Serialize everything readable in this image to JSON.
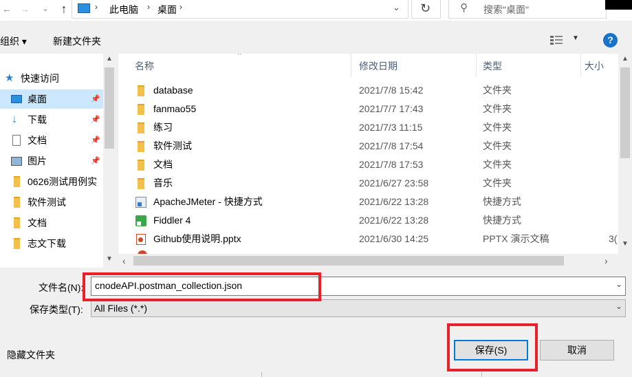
{
  "address": {
    "path": [
      "此电脑",
      "桌面"
    ],
    "search_placeholder": "搜索\"桌面\""
  },
  "toolbar": {
    "organize": "组织 ▾",
    "new_folder": "新建文件夹",
    "help": "?"
  },
  "sidebar": {
    "items": [
      {
        "label": "快速访问",
        "icon": "star-icon"
      },
      {
        "label": "桌面",
        "icon": "desktop-icon",
        "pinned": true,
        "selected": true
      },
      {
        "label": "下载",
        "icon": "download-icon",
        "pinned": true
      },
      {
        "label": "文档",
        "icon": "document-icon",
        "pinned": true
      },
      {
        "label": "图片",
        "icon": "picture-icon",
        "pinned": true
      },
      {
        "label": "0626测试用例实",
        "icon": "folder-icon"
      },
      {
        "label": "软件测试",
        "icon": "folder-icon"
      },
      {
        "label": "文档",
        "icon": "folder-icon"
      },
      {
        "label": "志文下载",
        "icon": "folder-icon"
      }
    ]
  },
  "columns": {
    "name": "名称",
    "date": "修改日期",
    "type": "类型",
    "size": "大小"
  },
  "files": [
    {
      "name": "database",
      "date": "2021/7/8 15:42",
      "type": "文件夹",
      "size": "",
      "icon": "folder-icon"
    },
    {
      "name": "fanmao55",
      "date": "2021/7/7 17:43",
      "type": "文件夹",
      "size": "",
      "icon": "folder-icon"
    },
    {
      "name": "练习",
      "date": "2021/7/3 11:15",
      "type": "文件夹",
      "size": "",
      "icon": "folder-icon"
    },
    {
      "name": "软件测试",
      "date": "2021/7/8 17:54",
      "type": "文件夹",
      "size": "",
      "icon": "folder-icon"
    },
    {
      "name": "文档",
      "date": "2021/7/8 17:53",
      "type": "文件夹",
      "size": "",
      "icon": "folder-icon"
    },
    {
      "name": "音乐",
      "date": "2021/6/27 23:58",
      "type": "文件夹",
      "size": "",
      "icon": "folder-icon"
    },
    {
      "name": "ApacheJMeter - 快捷方式",
      "date": "2021/6/22 13:28",
      "type": "快捷方式",
      "size": "",
      "icon": "shortcut-icon"
    },
    {
      "name": "Fiddler 4",
      "date": "2021/6/22 13:28",
      "type": "快捷方式",
      "size": "",
      "icon": "fiddler-icon"
    },
    {
      "name": "Github使用说明.pptx",
      "date": "2021/6/30 14:25",
      "type": "PPTX 演示文稿",
      "size": "3(",
      "icon": "pptx-icon"
    }
  ],
  "form": {
    "filename_label": "文件名(N):",
    "filename_value": "cnodeAPI.postman_collection.json",
    "filetype_label": "保存类型(T):",
    "filetype_value": "All Files (*.*)"
  },
  "footer": {
    "hide_folders": "隐藏文件夹",
    "save": "保存(S)",
    "cancel": "取消"
  },
  "colors": {
    "accent": "#0078d7",
    "highlight": "#e8202a",
    "selected_bg": "#cce8ff"
  }
}
